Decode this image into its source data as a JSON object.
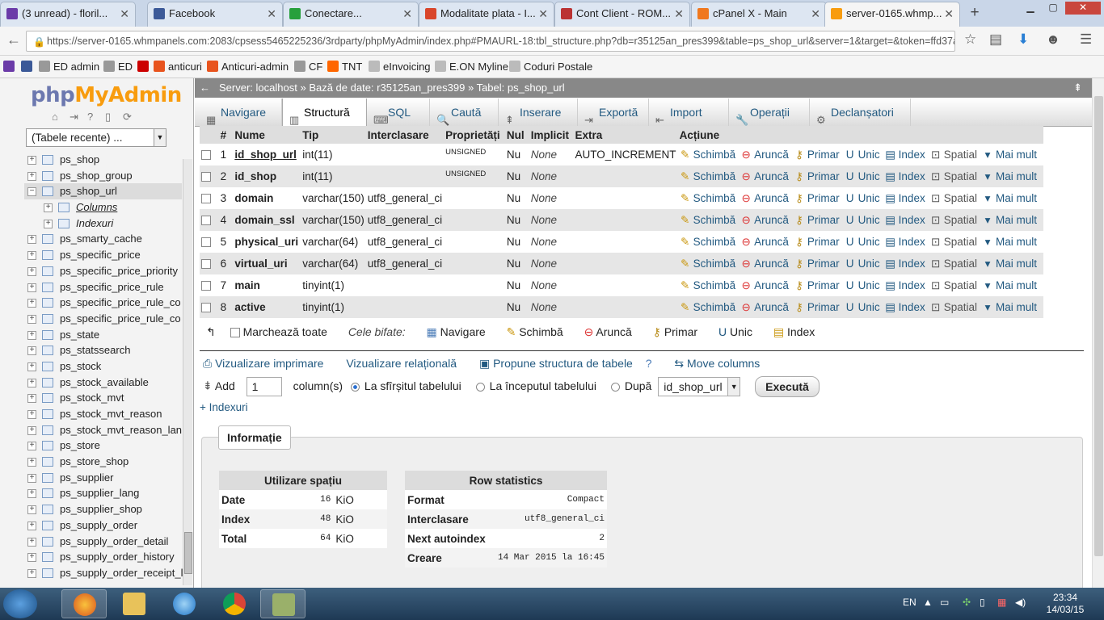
{
  "browser": {
    "tabs": [
      {
        "title": "(3 unread) - floril...",
        "icon_color": "#6b3ba8",
        "active": false
      },
      {
        "title": "Facebook",
        "icon_color": "#3b5998",
        "active": false
      },
      {
        "title": "Conectare...",
        "icon_color": "#27a03c",
        "active": false
      },
      {
        "title": "Modalitate plata - I...",
        "icon_color": "#d9462b",
        "active": false
      },
      {
        "title": "Cont Client - ROM...",
        "icon_color": "#b33",
        "active": false
      },
      {
        "title": "cPanel X - Main",
        "icon_color": "#f0781e",
        "active": false
      },
      {
        "title": "server-0165.whmp...",
        "icon_color": "#f89c0e",
        "active": true
      }
    ],
    "url": "https://server-0165.whmpanels.com:2083/cpsess5465225236/3rdparty/phpMyAdmin/index.php#PMAURL-18:tbl_structure.php?db=r35125an_pres399&table=ps_shop_url&server=1&target=&token=ffd37ac",
    "bookmarks": [
      {
        "label": "",
        "icon_color": "#6b3ba8"
      },
      {
        "label": "",
        "icon_color": "#3b5998"
      },
      {
        "label": "ED admin",
        "icon_color": "#999"
      },
      {
        "label": "ED",
        "icon_color": "#999"
      },
      {
        "label": "",
        "icon_color": "#c00"
      },
      {
        "label": "anticuri",
        "icon_color": "#e8541e"
      },
      {
        "label": "Anticuri-admin",
        "icon_color": "#e8541e"
      },
      {
        "label": "CF",
        "icon_color": "#999"
      },
      {
        "label": "TNT",
        "icon_color": "#f60"
      },
      {
        "label": "eInvoicing",
        "icon_color": "#bbb"
      },
      {
        "label": "E.ON Myline",
        "icon_color": "#bbb"
      },
      {
        "label": "Coduri Postale",
        "icon_color": "#bbb"
      }
    ]
  },
  "pma": {
    "logo_php": "php",
    "logo_myadmin": "MyAdmin",
    "recent_tables": "(Tabele recente) ...",
    "tree": [
      {
        "label": "ps_shop",
        "type": "table"
      },
      {
        "label": "ps_shop_group",
        "type": "table"
      },
      {
        "label": "ps_shop_url",
        "type": "table",
        "selected": true
      },
      {
        "label": "Columns",
        "type": "child",
        "underline": true
      },
      {
        "label": "Indexuri",
        "type": "child"
      },
      {
        "label": "ps_smarty_cache",
        "type": "table"
      },
      {
        "label": "ps_specific_price",
        "type": "table"
      },
      {
        "label": "ps_specific_price_priority",
        "type": "table"
      },
      {
        "label": "ps_specific_price_rule",
        "type": "table"
      },
      {
        "label": "ps_specific_price_rule_co",
        "type": "table"
      },
      {
        "label": "ps_specific_price_rule_co",
        "type": "table"
      },
      {
        "label": "ps_state",
        "type": "table"
      },
      {
        "label": "ps_statssearch",
        "type": "table"
      },
      {
        "label": "ps_stock",
        "type": "table"
      },
      {
        "label": "ps_stock_available",
        "type": "table"
      },
      {
        "label": "ps_stock_mvt",
        "type": "table"
      },
      {
        "label": "ps_stock_mvt_reason",
        "type": "table"
      },
      {
        "label": "ps_stock_mvt_reason_lan",
        "type": "table"
      },
      {
        "label": "ps_store",
        "type": "table"
      },
      {
        "label": "ps_store_shop",
        "type": "table"
      },
      {
        "label": "ps_supplier",
        "type": "table"
      },
      {
        "label": "ps_supplier_lang",
        "type": "table"
      },
      {
        "label": "ps_supplier_shop",
        "type": "table"
      },
      {
        "label": "ps_supply_order",
        "type": "table"
      },
      {
        "label": "ps_supply_order_detail",
        "type": "table"
      },
      {
        "label": "ps_supply_order_history",
        "type": "table"
      },
      {
        "label": "ps_supply_order_receipt_l",
        "type": "table"
      }
    ],
    "breadcrumb": {
      "server": "Server: localhost",
      "sep1": "»",
      "database": "Bază de date: r35125an_pres399",
      "sep2": "»",
      "table": "Tabel: ps_shop_url"
    },
    "menu": [
      {
        "label": "Navigare",
        "icon": "table-icon"
      },
      {
        "label": "Structură",
        "icon": "structure-icon",
        "active": true
      },
      {
        "label": "SQL",
        "icon": "sql-icon"
      },
      {
        "label": "Caută",
        "icon": "search-icon"
      },
      {
        "label": "Inserare",
        "icon": "insert-icon"
      },
      {
        "label": "Exportă",
        "icon": "export-icon"
      },
      {
        "label": "Import",
        "icon": "import-icon"
      },
      {
        "label": "Operații",
        "icon": "wrench-icon"
      },
      {
        "label": "Declanșatori",
        "icon": "triggers-icon"
      }
    ],
    "columns_header": {
      "num": "#",
      "name": "Nume",
      "type": "Tip",
      "collation": "Interclasare",
      "attributes": "Proprietăți",
      "null": "Nul",
      "default": "Implicit",
      "extra": "Extra",
      "action": "Acțiune"
    },
    "columns": [
      {
        "num": "1",
        "name": "id_shop_url",
        "type": "int(11)",
        "collation": "",
        "attributes": "UNSIGNED",
        "null": "Nu",
        "default": "None",
        "extra": "AUTO_INCREMENT",
        "primary_key": true
      },
      {
        "num": "2",
        "name": "id_shop",
        "type": "int(11)",
        "collation": "",
        "attributes": "UNSIGNED",
        "null": "Nu",
        "default": "None",
        "extra": ""
      },
      {
        "num": "3",
        "name": "domain",
        "type": "varchar(150)",
        "collation": "utf8_general_ci",
        "attributes": "",
        "null": "Nu",
        "default": "None",
        "extra": ""
      },
      {
        "num": "4",
        "name": "domain_ssl",
        "type": "varchar(150)",
        "collation": "utf8_general_ci",
        "attributes": "",
        "null": "Nu",
        "default": "None",
        "extra": ""
      },
      {
        "num": "5",
        "name": "physical_uri",
        "type": "varchar(64)",
        "collation": "utf8_general_ci",
        "attributes": "",
        "null": "Nu",
        "default": "None",
        "extra": ""
      },
      {
        "num": "6",
        "name": "virtual_uri",
        "type": "varchar(64)",
        "collation": "utf8_general_ci",
        "attributes": "",
        "null": "Nu",
        "default": "None",
        "extra": ""
      },
      {
        "num": "7",
        "name": "main",
        "type": "tinyint(1)",
        "collation": "",
        "attributes": "",
        "null": "Nu",
        "default": "None",
        "extra": ""
      },
      {
        "num": "8",
        "name": "active",
        "type": "tinyint(1)",
        "collation": "",
        "attributes": "",
        "null": "Nu",
        "default": "None",
        "extra": ""
      }
    ],
    "row_actions": {
      "change": "Schimbă",
      "drop": "Aruncă",
      "primary": "Primar",
      "unique": "Unic",
      "index": "Index",
      "spatial": "Spatial",
      "more": "Mai mult"
    },
    "with_selected": {
      "check_all": "Marchează toate",
      "label": "Cele bifate:",
      "browse": "Navigare",
      "change": "Schimbă",
      "drop": "Aruncă",
      "primary": "Primar",
      "unique": "Unic",
      "index": "Index"
    },
    "links": {
      "print": "Vizualizare imprimare",
      "relation": "Vizualizare relațională",
      "propose": "Propune structura de tabele",
      "move": "Move columns"
    },
    "add": {
      "label": "Add",
      "count": "1",
      "suffix": "column(s)",
      "opt_end": "La sfîrșitul tabelului",
      "opt_start": "La începutul tabelului",
      "opt_after": "După",
      "after_field": "id_shop_url",
      "execute": "Execută"
    },
    "indexes_toggle": "+ Indexuri",
    "info": {
      "legend": "Informație",
      "space": {
        "title": "Utilizare spațiu",
        "rows": [
          {
            "label": "Date",
            "value": "16",
            "unit": "KiO"
          },
          {
            "label": "Index",
            "value": "48",
            "unit": "KiO"
          },
          {
            "label": "Total",
            "value": "64",
            "unit": "KiO"
          }
        ]
      },
      "stats": {
        "title": "Row statistics",
        "rows": [
          {
            "label": "Format",
            "value": "Compact"
          },
          {
            "label": "Interclasare",
            "value": "utf8_general_ci"
          },
          {
            "label": "Next autoindex",
            "value": "2"
          },
          {
            "label": "Creare",
            "value": "14 Mar 2015 la 16:45"
          }
        ]
      }
    }
  },
  "taskbar": {
    "lang": "EN",
    "time": "23:34",
    "date": "14/03/15"
  }
}
